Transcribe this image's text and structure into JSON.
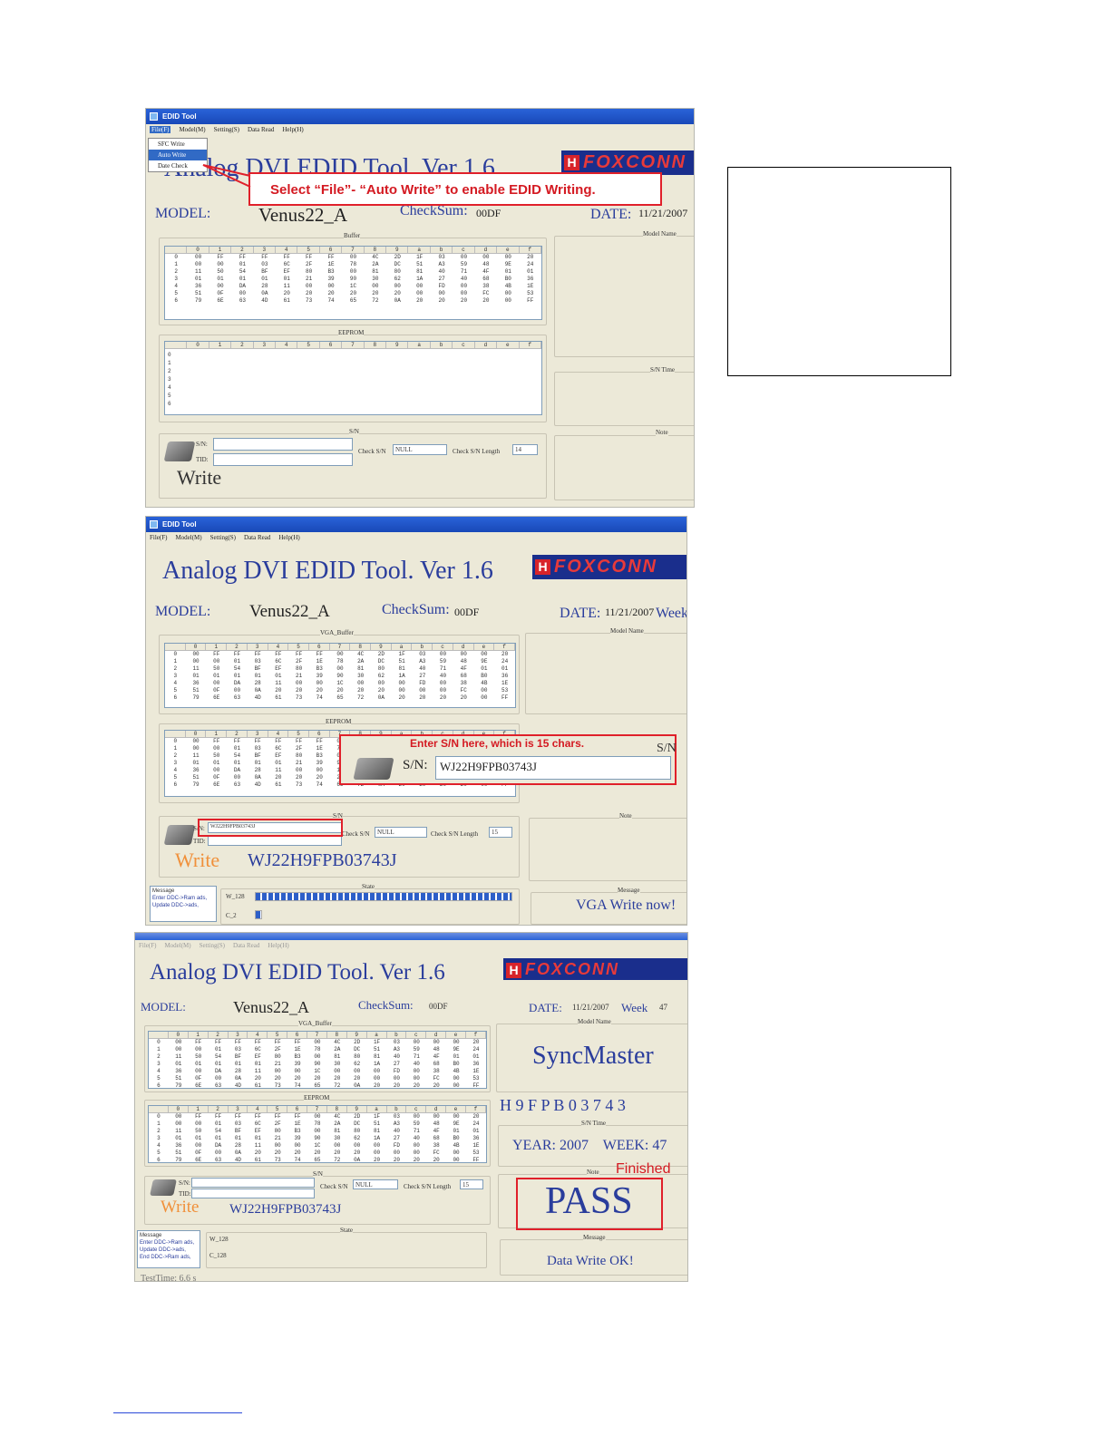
{
  "window_title": "EDID Tool",
  "menu": [
    "File(F)",
    "Model(M)",
    "Setting(S)",
    "Data Read",
    "Help(H)"
  ],
  "file_menu_items": [
    "SFC Write",
    "Auto Write",
    "Date Check"
  ],
  "app_title": "Analog DVI EDID Tool. Ver 1.6",
  "logo_text": "FOXCONN",
  "callout1": "Select “File”- “Auto Write” to enable EDID Writing.",
  "callout2": "Enter S/N here, which is 15 chars.",
  "labels": {
    "model": "MODEL:",
    "checksum": "CheckSum:",
    "date": "DATE:",
    "week": "Week",
    "buffer": "Buffer",
    "vga_buffer": "VGA_Buffer",
    "eeprom": "EEPROM",
    "model_name": "Model Name",
    "sn_time": "S/N Time",
    "note": "Note",
    "sn_group": "S/N",
    "sn": "S/N:",
    "tid": "TID:",
    "check_sn": "Check S/N",
    "check_sn_length": "Check S/N Length",
    "write": "Write",
    "state": "State",
    "message": "Message"
  },
  "values": {
    "model": "Venus22_A",
    "checksum": "00DF",
    "date": "11/21/2007",
    "week_num": "47",
    "check_sn": "NULL",
    "sn_len1": "14",
    "sn_len2": "15",
    "serial": "WJ22H9FPB03743J",
    "w128": "W_128",
    "c2": "C_2",
    "c128": "C_128",
    "vga_write_now": "VGA Write now!",
    "syncmaster": "SyncMaster",
    "sn_partial": "H 9 F P B 0 3 7 4 3",
    "year_week": "YEAR: 2007    WEEK: 47",
    "finished": "Finished",
    "pass": "PASS",
    "data_write_ok": "Data Write OK!",
    "test_time": "TestTime: 6.6 s"
  },
  "messages2": [
    "Message",
    "Enter DDC->Ram ads,",
    "Update DDC->ads,"
  ],
  "messages3": [
    "Message",
    "Enter DDC->Ram ads,",
    "Update DDC->ads,",
    "End DDC->Ram ads,"
  ],
  "grid_cols": [
    "0",
    "1",
    "2",
    "3",
    "4",
    "5",
    "6",
    "7",
    "8",
    "9",
    "a",
    "b",
    "c",
    "d",
    "e",
    "f"
  ],
  "grid_rows_idx": [
    "0",
    "1",
    "2",
    "3",
    "4",
    "5",
    "6"
  ],
  "buffer_rows": [
    [
      "00",
      "FF",
      "FF",
      "FF",
      "FF",
      "FF",
      "FF",
      "00",
      "4C",
      "2D",
      "1F",
      "03",
      "00",
      "00",
      "00",
      "20"
    ],
    [
      "00",
      "00",
      "01",
      "03",
      "6C",
      "2F",
      "1E",
      "78",
      "2A",
      "DC",
      "51",
      "A3",
      "59",
      "48",
      "9E",
      "24"
    ],
    [
      "11",
      "50",
      "54",
      "BF",
      "EF",
      "80",
      "B3",
      "00",
      "81",
      "80",
      "81",
      "40",
      "71",
      "4F",
      "01",
      "01"
    ],
    [
      "01",
      "01",
      "01",
      "01",
      "01",
      "21",
      "39",
      "90",
      "30",
      "62",
      "1A",
      "27",
      "40",
      "68",
      "B0",
      "36"
    ],
    [
      "36",
      "00",
      "DA",
      "28",
      "11",
      "00",
      "00",
      "1C",
      "00",
      "00",
      "00",
      "FD",
      "00",
      "38",
      "4B",
      "1E"
    ],
    [
      "51",
      "0F",
      "00",
      "0A",
      "20",
      "20",
      "20",
      "20",
      "20",
      "20",
      "00",
      "00",
      "00",
      "FC",
      "00",
      "53"
    ],
    [
      "79",
      "6E",
      "63",
      "4D",
      "61",
      "73",
      "74",
      "65",
      "72",
      "0A",
      "20",
      "20",
      "20",
      "20",
      "00",
      "FF"
    ]
  ],
  "colors": {
    "accent": "#2a3d9c",
    "red": "#e0202a",
    "pass_blue": "#2a3d9c"
  }
}
